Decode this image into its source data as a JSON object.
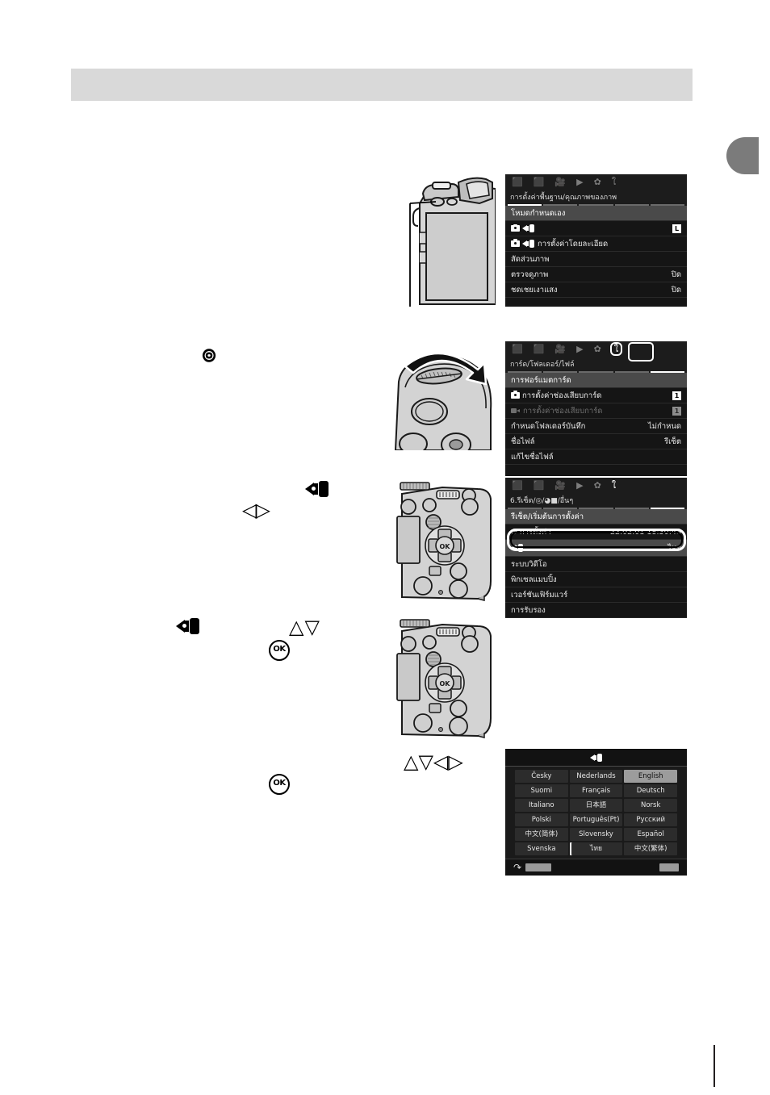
{
  "page": {
    "background": "#ffffff",
    "header_band_color": "#d9d9d9",
    "edge_tab_color": "#7b7b7b"
  },
  "steps": {
    "step1": {
      "glyphs": []
    },
    "step2": {
      "wrench_glyph": "๏",
      "glyphs": []
    },
    "step3": {
      "speaker_glyph": "speaker-icon",
      "left_right_glyph": "◁▷"
    },
    "step4": {
      "speaker_glyph": "speaker-icon",
      "up_down_glyph": "△▽",
      "ok_label": "OK"
    },
    "step5": {
      "arrows_glyph": "△▽◁▷",
      "ok_label": "OK"
    }
  },
  "menu1": {
    "tabs": [
      {
        "icon": "camera-icon",
        "active": true
      },
      {
        "icon": "camera2-icon",
        "active": false
      },
      {
        "icon": "movie-icon",
        "active": false
      },
      {
        "icon": "playback-icon",
        "active": false
      },
      {
        "icon": "gear-icon",
        "active": false
      },
      {
        "icon": "wrench-icon",
        "active": false
      }
    ],
    "title": "การตั้งค่าพื้นฐาน/คุณภาพของภาพ",
    "segments": [
      true,
      false,
      false,
      false,
      false
    ],
    "rows": [
      {
        "label": "โหมดกำหนดเอง",
        "value": "",
        "selected": true,
        "icon": ""
      },
      {
        "label": "",
        "value": "L",
        "value_badge": true,
        "icon": "camera-speaker-icon"
      },
      {
        "label": "การตั้งค่าโดยละเอียด",
        "value": "",
        "icon": "camera-speaker-icon"
      },
      {
        "label": "สัดส่วนภาพ",
        "value": "",
        "icon": ""
      },
      {
        "label": "ตรวจดูภาพ",
        "value": "ปิด",
        "icon": ""
      },
      {
        "label": "ชดเชยเงาแสง",
        "value": "ปิด",
        "icon": ""
      }
    ]
  },
  "menu2": {
    "tabs": [
      {
        "icon": "camera-icon",
        "active": false
      },
      {
        "icon": "camera2-icon",
        "active": false
      },
      {
        "icon": "movie-icon",
        "active": false
      },
      {
        "icon": "playback-icon",
        "active": false
      },
      {
        "icon": "gear-icon",
        "active": false
      },
      {
        "icon": "wrench-icon",
        "active": true,
        "highlighted": true
      }
    ],
    "title": "การ์ด/โฟลเดอร์/ไฟล์",
    "segments": [
      false,
      false,
      false,
      false,
      true
    ],
    "rows": [
      {
        "label": "การฟอร์แมตการ์ด",
        "value": "",
        "selected": true,
        "icon": ""
      },
      {
        "label": "การตั้งค่าช่องเสียบการ์ด",
        "value": "1",
        "value_badge": true,
        "icon": "camera-icon"
      },
      {
        "label": "การตั้งค่าช่องเสียบการ์ด",
        "value": "1",
        "value_badge": true,
        "dim": true,
        "icon": "movie-icon"
      },
      {
        "label": "กำหนดโฟลเดอร์บันทึก",
        "value": "ไม่กำหนด",
        "icon": ""
      },
      {
        "label": "ชื่อไฟล์",
        "value": "รีเซ็ต",
        "icon": ""
      },
      {
        "label": "แก้ไขชื่อไฟล์",
        "value": "",
        "icon": ""
      }
    ]
  },
  "menu3": {
    "tabs": [
      {
        "icon": "camera-icon",
        "active": false
      },
      {
        "icon": "camera2-icon",
        "active": false
      },
      {
        "icon": "movie-icon",
        "active": false
      },
      {
        "icon": "playback-icon",
        "active": false
      },
      {
        "icon": "gear-icon",
        "active": false
      },
      {
        "icon": "wrench-icon",
        "active": true
      }
    ],
    "title": "6.รีเซ็ต/◎/◕■/อื่นๆ",
    "segments": [
      false,
      false,
      false,
      false,
      true
    ],
    "rows": [
      {
        "label": "รีเซ็ต/เริ่มต้นการตั้งค่า",
        "value": "",
        "selected": true,
        "icon": ""
      },
      {
        "label": "การตั้งค่า",
        "value": "'22.02.01 18:30:43",
        "icon": "clock-icon"
      },
      {
        "label": "",
        "value": "ไทย",
        "highlighted": true,
        "icon": "speaker-icon"
      },
      {
        "label": "ระบบวิดีโอ",
        "value": "",
        "icon": ""
      },
      {
        "label": "พิกเซลแมบปิ้ง",
        "value": "",
        "icon": ""
      },
      {
        "label": "เวอร์ชันเฟิร์มแวร์",
        "value": "",
        "icon": ""
      },
      {
        "label": "การรับรอง",
        "value": "",
        "icon": ""
      }
    ]
  },
  "language_screen": {
    "title_icon": "speaker-icon",
    "grid": [
      [
        {
          "label": "Česky"
        },
        {
          "label": "Nederlands"
        },
        {
          "label": "English",
          "selected": true
        }
      ],
      [
        {
          "label": "Suomi"
        },
        {
          "label": "Français"
        },
        {
          "label": "Deutsch"
        }
      ],
      [
        {
          "label": "Italiano"
        },
        {
          "label": "日本語"
        },
        {
          "label": "Norsk"
        }
      ],
      [
        {
          "label": "Polski"
        },
        {
          "label": "Português(Pt)"
        },
        {
          "label": "Русский"
        }
      ],
      [
        {
          "label": "中文(简体)"
        },
        {
          "label": "Slovensky"
        },
        {
          "label": "Español"
        }
      ],
      [
        {
          "label": "Svenska"
        },
        {
          "label": "ไทย",
          "cursor": true
        },
        {
          "label": "中文(繁体)"
        }
      ]
    ],
    "footer": {
      "back_icon": "back-arrow-icon",
      "left_chip": "",
      "right_chip": ""
    }
  }
}
